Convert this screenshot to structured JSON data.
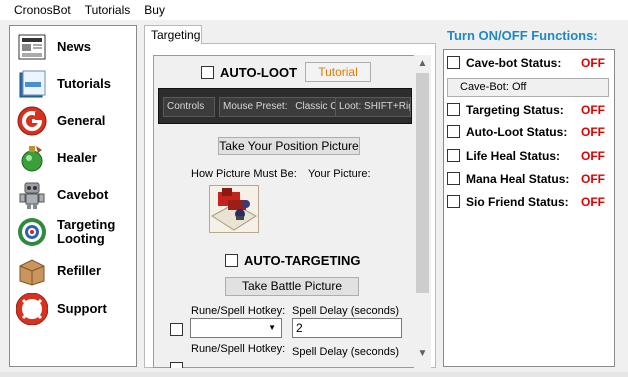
{
  "menu": [
    "CronosBot",
    "Tutorials",
    "Buy"
  ],
  "nav": [
    {
      "label": "News",
      "icon": "news-icon"
    },
    {
      "label": "Tutorials",
      "icon": "tutorials-icon"
    },
    {
      "label": "General",
      "icon": "general-icon"
    },
    {
      "label": "Healer",
      "icon": "healer-icon"
    },
    {
      "label": "Cavebot",
      "icon": "cavebot-icon"
    },
    {
      "label": "Targeting\nLooting",
      "icon": "targeting-icon"
    },
    {
      "label": "Refiller",
      "icon": "refiller-icon"
    },
    {
      "label": "Support",
      "icon": "support-icon"
    }
  ],
  "tab": {
    "label": "Targeting"
  },
  "targeting": {
    "autoloot_label": "AUTO-LOOT",
    "tutorial_button": "Tutorial",
    "game_strip": {
      "controls": "Controls",
      "mouse_preset_label": "Mouse Preset:",
      "mouse_preset_value": "Classic Controls",
      "loot_label": "Loot: SHIFT+Right"
    },
    "take_position_button": "Take Your Position Picture",
    "how_picture_label": "How Picture Must Be:",
    "your_picture_label": "Your Picture:",
    "autotargeting_label": "AUTO-TARGETING",
    "take_battle_button": "Take Battle Picture",
    "rune_hotkey_label": "Rune/Spell Hotkey:",
    "spell_delay_label": "Spell Delay (seconds)",
    "spell_delay_value": "2",
    "rune_hotkey_label_2": "Rune/Spell Hotkey:",
    "spell_delay_label_2": "Spell Delay (seconds)"
  },
  "right": {
    "title": "Turn ON/OFF Functions:",
    "cavebot_status_label": "Cave-bot Status:",
    "cavebot_status_value": "OFF",
    "cavebot_box": "Cave-Bot: Off",
    "targeting_status_label": "Targeting Status:",
    "targeting_status_value": "OFF",
    "autoloot_status_label": "Auto-Loot Status:",
    "autoloot_status_value": "OFF",
    "lifeheal_status_label": "Life Heal Status:",
    "lifeheal_status_value": "OFF",
    "manaheal_status_label": "Mana Heal Status:",
    "manaheal_status_value": "OFF",
    "siofriend_status_label": "Sio Friend Status:",
    "siofriend_status_value": "OFF"
  },
  "colors": {
    "accent_title": "#1e88c7",
    "off_red": "#e00000",
    "tutorial_orange": "#e07b00"
  }
}
